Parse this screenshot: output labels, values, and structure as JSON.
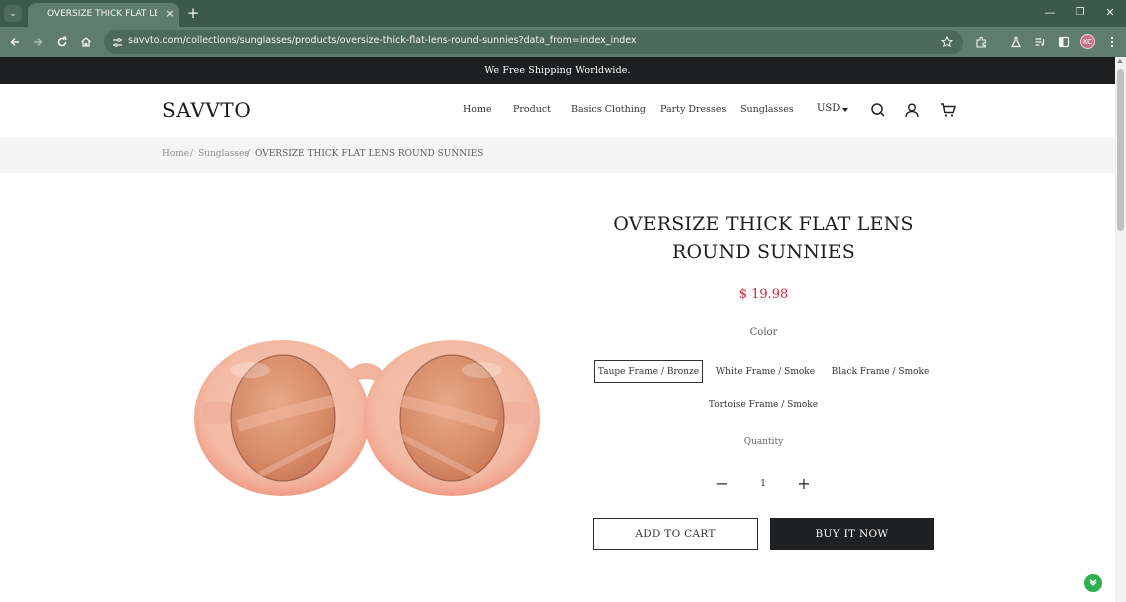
{
  "browser": {
    "tab_title": "OVERSIZE THICK FLAT LENS RO",
    "tab_close": "×",
    "new_tab": "+",
    "tab_list": "⌄",
    "window_minimize": "—",
    "window_restore": "❐",
    "window_close": "✕",
    "url": "savvto.com/collections/sunglasses/products/oversize-thick-flat-lens-round-sunnies?data_from=index_index",
    "profile_initials": "KC"
  },
  "announcement": "We Free Shipping Worldwide.",
  "header": {
    "logo": "SAVVTO",
    "nav": [
      "Home",
      "Product",
      "Basics Clothing",
      "Party Dresses",
      "Sunglasses"
    ],
    "currency": "USD"
  },
  "breadcrumb": {
    "items": [
      "Home",
      "Sunglasses"
    ],
    "separator": "/",
    "current": "OVERSIZE THICK FLAT LENS ROUND SUNNIES"
  },
  "product": {
    "title": "OVERSIZE THICK FLAT LENS ROUND SUNNIES",
    "price": "$ 19.98",
    "color_label": "Color",
    "variants": [
      "Taupe Frame / Bronze",
      "White Frame / Smoke",
      "Black Frame / Smoke",
      "Tortoise Frame / Smoke"
    ],
    "selected_variant": "Taupe Frame / Bronze",
    "quantity_label": "Quantity",
    "quantity": "1",
    "qty_minus": "−",
    "qty_plus": "+",
    "add_to_cart": "ADD TO CART",
    "buy_now": "BUY IT NOW"
  },
  "colors": {
    "accent_price": "#d2233a",
    "announcement_bg": "#1d1f20",
    "buy_button_bg": "#1f2022",
    "browser_chrome": "#5f7d6c"
  }
}
